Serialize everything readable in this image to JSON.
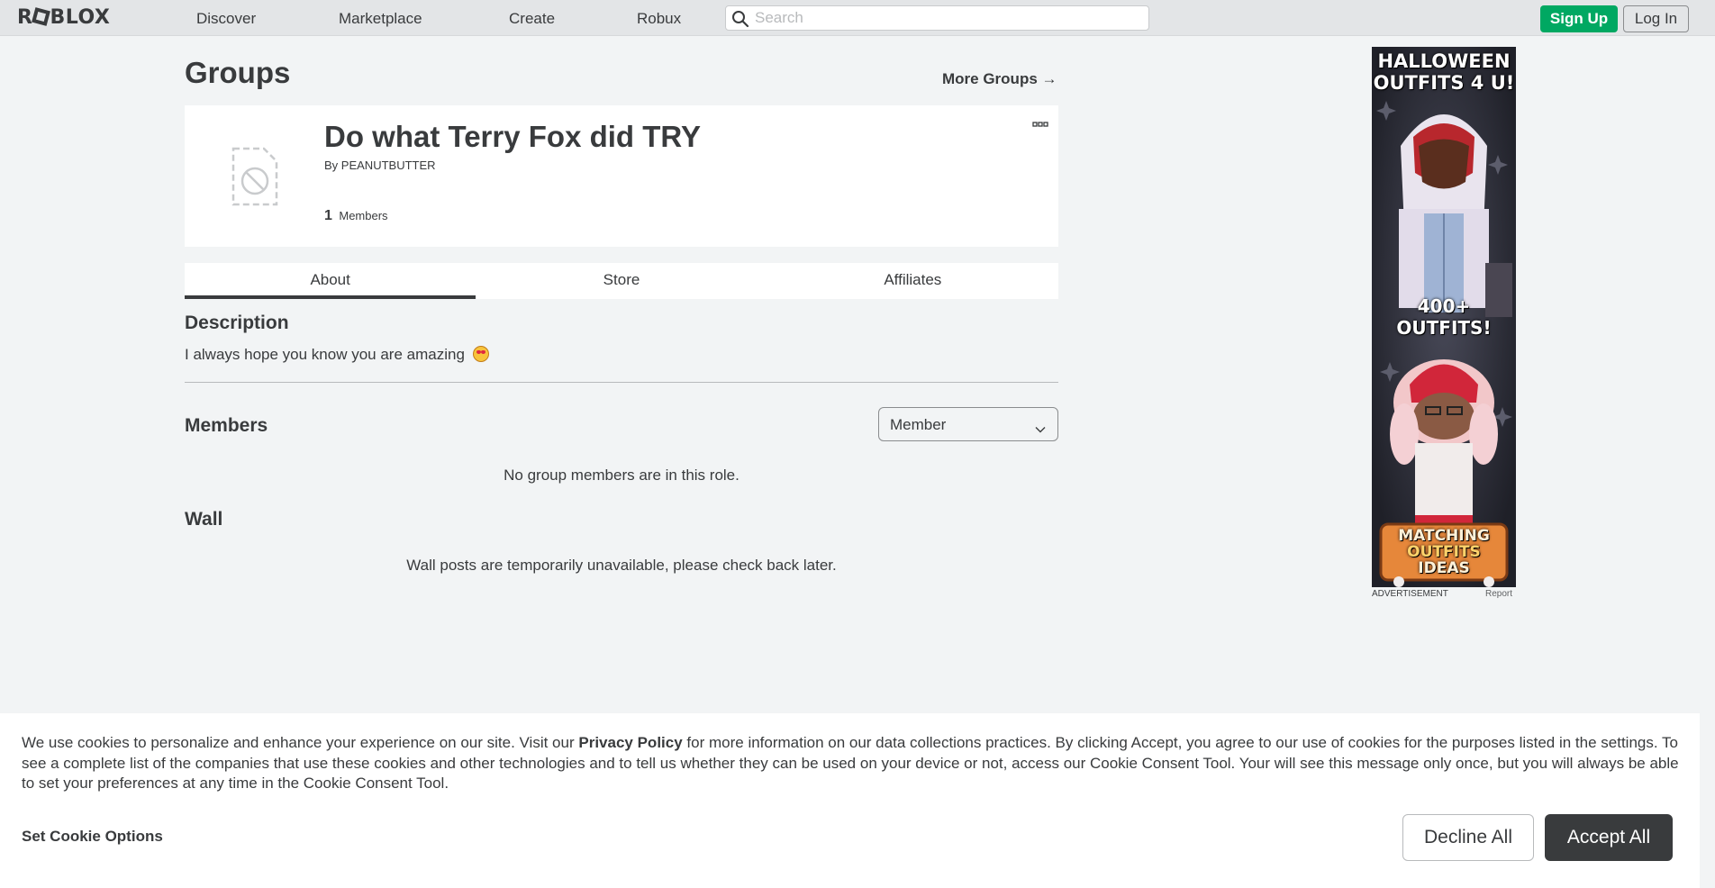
{
  "nav": {
    "logo": "ROBLOX",
    "links": [
      "Discover",
      "Marketplace",
      "Create",
      "Robux"
    ],
    "search_placeholder": "Search",
    "signup_label": "Sign Up",
    "login_label": "Log In"
  },
  "page": {
    "title": "Groups",
    "more_groups_label": "More Groups",
    "more_groups_arrow": "→"
  },
  "group": {
    "name": "Do what Terry Fox did TRY",
    "owner_prefix": "By",
    "owner_name": "PEANUTBUTTER",
    "member_count": "1",
    "member_label": "Members"
  },
  "tabs": [
    {
      "label": "About",
      "active": true
    },
    {
      "label": "Store",
      "active": false
    },
    {
      "label": "Affiliates",
      "active": false
    }
  ],
  "description": {
    "title": "Description",
    "text": "I always hope you know you are amazing",
    "emoji": "star-struck-emoji"
  },
  "members": {
    "title": "Members",
    "role_selected": "Member",
    "empty_message": "No group members are in this role."
  },
  "wall": {
    "title": "Wall",
    "message": "Wall posts are temporarily unavailable, please check back later."
  },
  "ad": {
    "headline": "HALLOWEEN OUTFITS 4 U!",
    "subheadline": "400+ OUTFITS!",
    "logo_text_1": "MATCHING",
    "logo_text_2": "OUTFITS",
    "logo_text_3": "IDEAS",
    "label": "ADVERTISEMENT",
    "report": "Report"
  },
  "cookie": {
    "text_before_link": "We use cookies to personalize and enhance your experience on our site. Visit our",
    "link_text": "Privacy Policy",
    "text_after_link": "for more information on our data collections practices. By clicking Accept, you agree to our use of cookies for the purposes listed in the settings. To see a complete list of the companies that use these cookies and other technologies and to tell us whether they can be used on your device or not, access our Cookie Consent Tool. Your will see this message only once, but you will always be able to set your preferences at any time in the Cookie Consent Tool.",
    "set_options": "Set Cookie Options",
    "decline": "Decline All",
    "accept": "Accept All"
  },
  "colors": {
    "signup_green": "#00a862",
    "text_dark": "#393b3d",
    "page_bg": "#f2f4f5",
    "nav_bg": "#e3e5e7"
  }
}
